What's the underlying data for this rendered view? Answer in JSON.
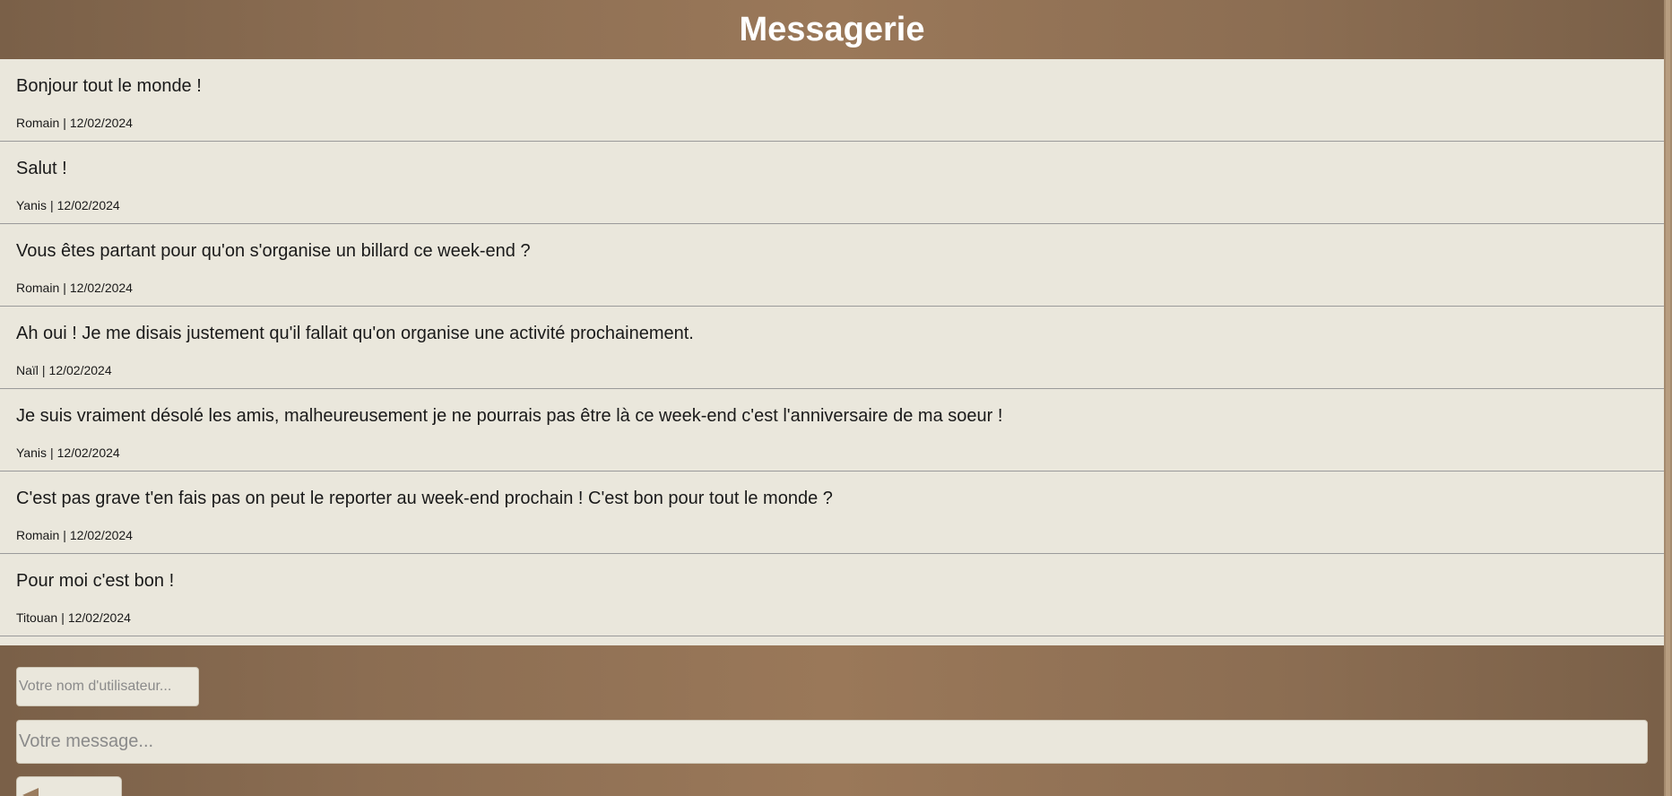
{
  "header": {
    "title": "Messagerie"
  },
  "messages": [
    {
      "text": "Bonjour tout le monde !",
      "author": "Romain",
      "date": "12/02/2024"
    },
    {
      "text": "Salut !",
      "author": "Yanis",
      "date": "12/02/2024"
    },
    {
      "text": "Vous êtes partant pour qu'on s'organise un billard ce week-end ?",
      "author": "Romain",
      "date": "12/02/2024"
    },
    {
      "text": "Ah oui ! Je me disais justement qu'il fallait qu'on organise une activité prochainement.",
      "author": "Naïl",
      "date": "12/02/2024"
    },
    {
      "text": "Je suis vraiment désolé les amis, malheureusement je ne pourrais pas être là ce week-end c'est l'anniversaire de ma soeur !",
      "author": "Yanis",
      "date": "12/02/2024"
    },
    {
      "text": "C'est pas grave t'en fais pas on peut le reporter au week-end prochain ! C'est bon pour tout le monde ?",
      "author": "Romain",
      "date": "12/02/2024"
    },
    {
      "text": "Pour moi c'est bon !",
      "author": "Titouan",
      "date": "12/02/2024"
    }
  ],
  "meta_separator": "|",
  "form": {
    "username_placeholder": "Votre nom d'utilisateur...",
    "username_value": "",
    "message_placeholder": "Votre message...",
    "message_value": "",
    "send_icon": "send-icon"
  },
  "colors": {
    "header_brown": "#8b6d52",
    "message_area": "#eae7dc",
    "divider": "#9a9a9a"
  }
}
